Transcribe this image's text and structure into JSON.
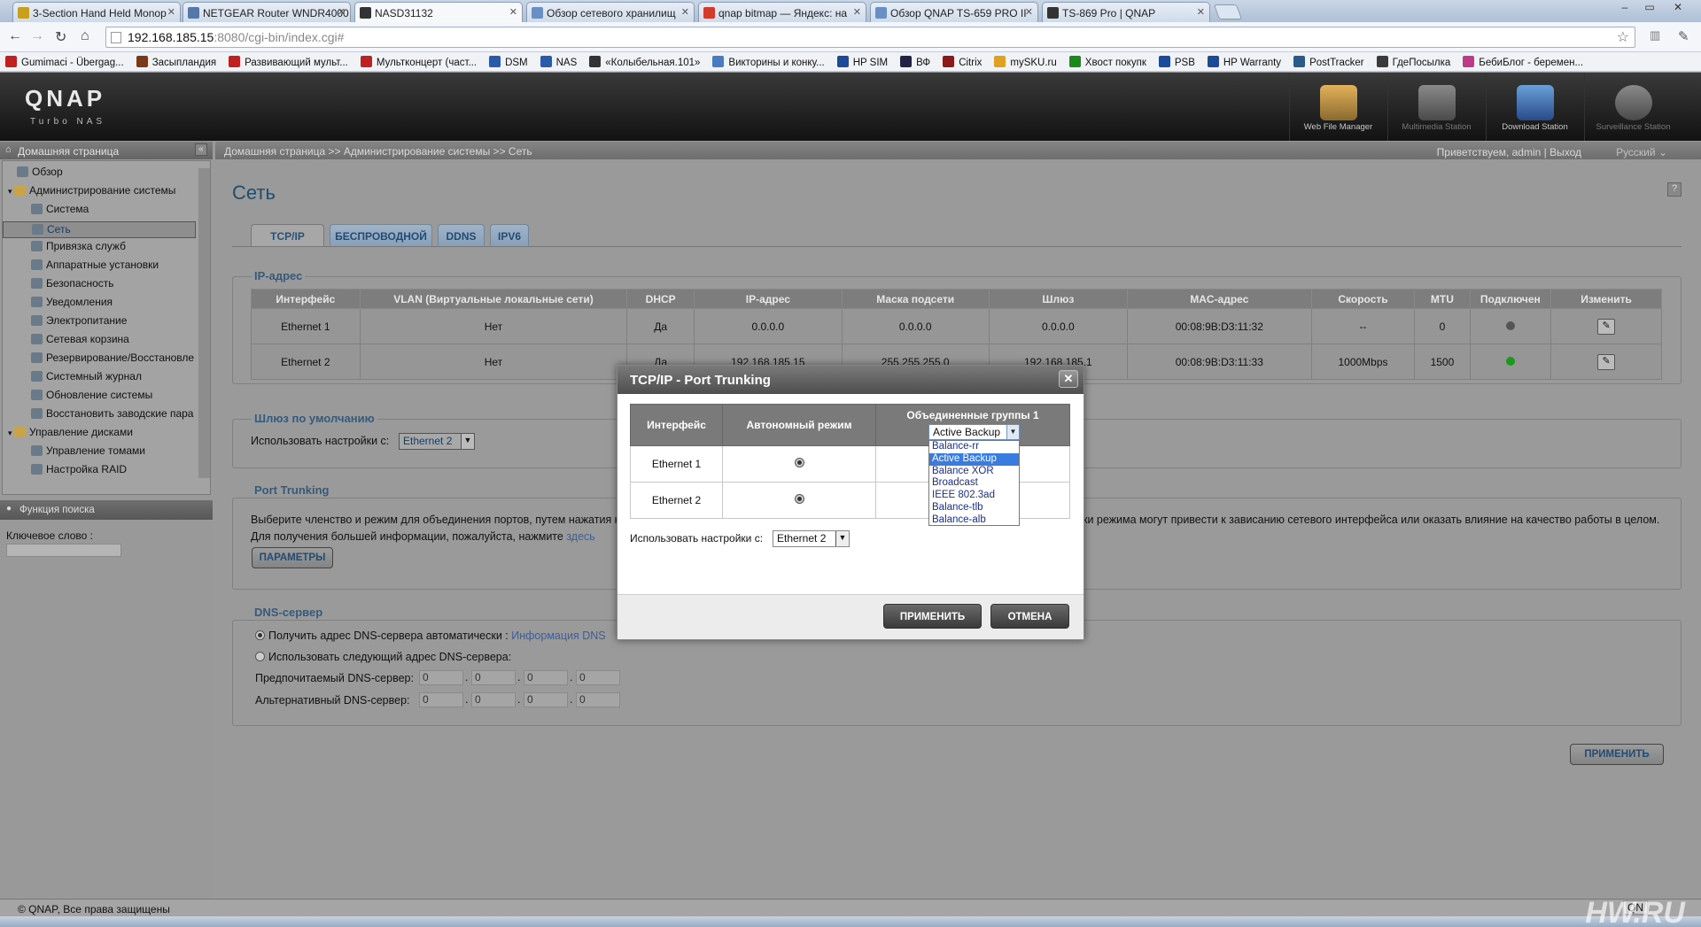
{
  "browser": {
    "tabs": [
      {
        "label": "3-Section Hand Held Monop",
        "fav": "#c7a020"
      },
      {
        "label": "NETGEAR Router WNDR4000",
        "fav": "#5578a8"
      },
      {
        "label": "NASD31132",
        "fav": "#333333",
        "active": true
      },
      {
        "label": "Обзор сетевого хранилищ",
        "fav": "#6a8fc4"
      },
      {
        "label": "qnap bitmap — Яндекс: на",
        "fav": "#d23b2b"
      },
      {
        "label": "Обзор QNAP TS-659 PRO II",
        "fav": "#6a8fc4"
      },
      {
        "label": "TS-869 Pro | QNAP",
        "fav": "#333333"
      }
    ],
    "window_controls": [
      "–",
      "▭",
      "✕"
    ],
    "url_host": "192.168.185.15",
    "url_rest": ":8080/cgi-bin/index.cgi#",
    "bookmarks": [
      {
        "label": "Gumimaci - Übergag...",
        "color": "#c02020"
      },
      {
        "label": "Засыпландия",
        "color": "#7a3a1a"
      },
      {
        "label": "Развивающий мульт...",
        "color": "#c02020"
      },
      {
        "label": "Мультконцерт (част...",
        "color": "#c02020"
      },
      {
        "label": "DSM",
        "color": "#2b5aa8"
      },
      {
        "label": "NAS",
        "color": "#2b5aa8"
      },
      {
        "label": "«Колыбельная.101»",
        "color": "#333333"
      },
      {
        "label": "Викторины и конку...",
        "color": "#4a7ac0"
      },
      {
        "label": "HP SIM",
        "color": "#1a4a9a"
      },
      {
        "label": "ВФ",
        "color": "#222244"
      },
      {
        "label": "Citrix",
        "color": "#8a1a1a"
      },
      {
        "label": "mySKU.ru",
        "color": "#e0a020"
      },
      {
        "label": "Хвост покупк",
        "color": "#1a8a1a"
      },
      {
        "label": "PSB",
        "color": "#1a4a9a"
      },
      {
        "label": "HP Warranty",
        "color": "#1a4a9a"
      },
      {
        "label": "PostTracker",
        "color": "#2a5a8a"
      },
      {
        "label": "ГдеПосылка",
        "color": "#3a3a3a"
      },
      {
        "label": "БебиБлог - беремен...",
        "color": "#c03a8a"
      }
    ]
  },
  "qnap": {
    "logo": "QNAP",
    "logo_sub": "Turbo NAS",
    "apps": [
      "Web File Manager",
      "Multimedia Station",
      "Download Station",
      "Surveillance Station"
    ]
  },
  "left": {
    "header": "Домашняя страница",
    "tree": [
      {
        "label": "Обзор",
        "level": 1,
        "folder": false
      },
      {
        "label": "Администрирование системы",
        "level": 0,
        "folder": true
      },
      {
        "label": "Система",
        "level": 2,
        "folder": false
      },
      {
        "label": "Сеть",
        "level": 2,
        "folder": false,
        "selected": true
      },
      {
        "label": "Привязка служб",
        "level": 2,
        "folder": false
      },
      {
        "label": "Аппаратные установки",
        "level": 2,
        "folder": false
      },
      {
        "label": "Безопасность",
        "level": 2,
        "folder": false
      },
      {
        "label": "Уведомления",
        "level": 2,
        "folder": false
      },
      {
        "label": "Электропитание",
        "level": 2,
        "folder": false
      },
      {
        "label": "Сетевая корзина",
        "level": 2,
        "folder": false
      },
      {
        "label": "Резервирование/Восстановле",
        "level": 2,
        "folder": false
      },
      {
        "label": "Системный журнал",
        "level": 2,
        "folder": false
      },
      {
        "label": "Обновление системы",
        "level": 2,
        "folder": false
      },
      {
        "label": "Восстановить заводские пара",
        "level": 2,
        "folder": false
      },
      {
        "label": "Управление дисками",
        "level": 0,
        "folder": true
      },
      {
        "label": "Управление томами",
        "level": 2,
        "folder": false
      },
      {
        "label": "Настройка RAID",
        "level": 2,
        "folder": false
      }
    ],
    "search_header": "Функция поиска",
    "keyword_label": "Ключевое слово :"
  },
  "main": {
    "breadcrumb": "Домашняя страница >> Администрирование системы >> Сеть",
    "greeting": "Приветствуем, admin | Выход",
    "language": "Русский",
    "title": "Сеть",
    "tabs": [
      "TCP/IP",
      "БЕСПРОВОДНОЙ",
      "DDNS",
      "IPV6"
    ],
    "ip_section": "IP-адрес",
    "ip_columns": [
      "Интерфейс",
      "VLAN (Виртуальные локальные сети)",
      "DHCP",
      "IP-адрес",
      "Маска подсети",
      "Шлюз",
      "MAC-адрес",
      "Скорость",
      "MTU",
      "Подключен",
      "Изменить"
    ],
    "ip_rows": [
      [
        "Ethernet 1",
        "Нет",
        "Да",
        "0.0.0.0",
        "0.0.0.0",
        "0.0.0.0",
        "00:08:9B:D3:11:32",
        "--",
        "0"
      ],
      [
        "Ethernet 2",
        "Нет",
        "Да",
        "192.168.185.15",
        "255.255.255.0",
        "192.168.185.1",
        "00:08:9B:D3:11:33",
        "1000Mbps",
        "1500"
      ]
    ],
    "connected": [
      false,
      true
    ],
    "gateway_section": "Шлюз по умолчанию",
    "gateway_label": "Использовать настройки с:",
    "gateway_value": "Ethernet 2",
    "trunk_section": "Port Trunking",
    "trunk_text1": "Выберите членство и режим для объединения портов, путем нажатия к",
    "trunk_text1b": "ки режима могут привести к зависанию сетевого интерфейса или оказать влияние на качество работы в целом.",
    "trunk_text2": "Для получения большей информации, пожалуйста, нажмите",
    "trunk_link": "здесь",
    "params_button": "ПАРАМЕТРЫ",
    "dns_section": "DNS-сервер",
    "dns_auto": "Получить адрес DNS-сервера автоматически :",
    "dns_info_link": "Информация DNS",
    "dns_manual": "Использовать следующий адрес DNS-сервера:",
    "dns_pref_label": "Предпочитаемый DNS-сервер:",
    "dns_alt_label": "Альтернативный DNS-сервер:",
    "dns_pref": [
      "0",
      "0",
      "0",
      "0"
    ],
    "dns_alt": [
      "0",
      "0",
      "0",
      "0"
    ],
    "apply_button": "ПРИМЕНИТЬ"
  },
  "modal": {
    "title": "TCP/IP - Port Trunking",
    "close": "✕",
    "col_interface": "Интерфейс",
    "col_standalone": "Автономный режим",
    "col_group": "Объединенные группы 1",
    "rows": [
      "Ethernet 1",
      "Ethernet 2"
    ],
    "mode_selected": "Active Backup",
    "mode_options": [
      "Balance-rr",
      "Active Backup",
      "Balance XOR",
      "Broadcast",
      "IEEE 802.3ad",
      "Balance-tlb",
      "Balance-alb"
    ],
    "use_settings_label": "Использовать настройки с:",
    "use_settings_value": "Ethernet 2",
    "apply": "ПРИМЕНИТЬ",
    "cancel": "ОТМЕНА"
  },
  "footer": {
    "copyright": "© QNAP, Все права защищены",
    "taskbar_item": "QN",
    "watermark": "HW.RU"
  }
}
